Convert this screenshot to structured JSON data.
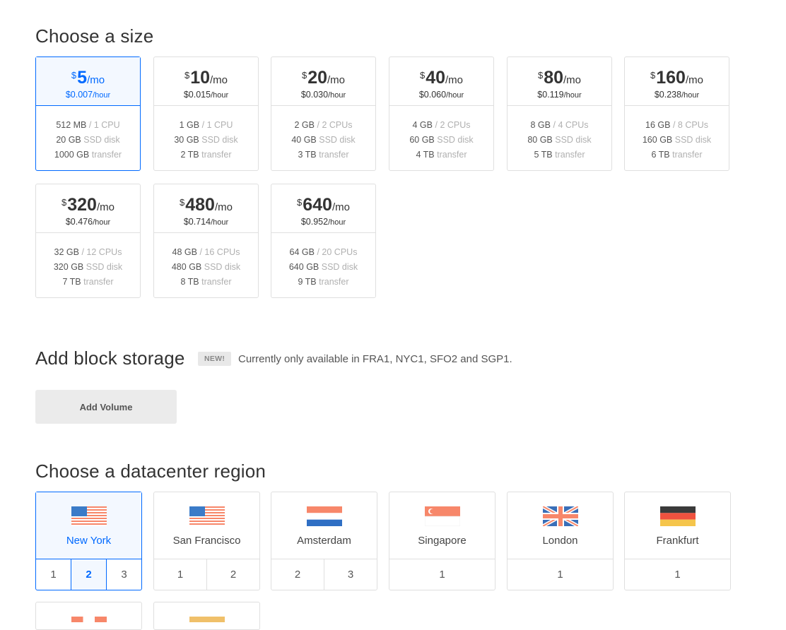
{
  "sizes_section": {
    "title": "Choose a size"
  },
  "sizes": [
    {
      "currency": "$",
      "amount": "5",
      "per": "/mo",
      "hourly": "$0.007",
      "hour_unit": "/hour",
      "ram": "512 MB",
      "cpu": "1 CPU",
      "disk": "20 GB",
      "disk_label": "SSD disk",
      "transfer": "1000 GB",
      "transfer_label": "transfer",
      "selected": true
    },
    {
      "currency": "$",
      "amount": "10",
      "per": "/mo",
      "hourly": "$0.015",
      "hour_unit": "/hour",
      "ram": "1 GB",
      "cpu": "1 CPU",
      "disk": "30 GB",
      "disk_label": "SSD disk",
      "transfer": "2 TB",
      "transfer_label": "transfer",
      "selected": false
    },
    {
      "currency": "$",
      "amount": "20",
      "per": "/mo",
      "hourly": "$0.030",
      "hour_unit": "/hour",
      "ram": "2 GB",
      "cpu": "2 CPUs",
      "disk": "40 GB",
      "disk_label": "SSD disk",
      "transfer": "3 TB",
      "transfer_label": "transfer",
      "selected": false
    },
    {
      "currency": "$",
      "amount": "40",
      "per": "/mo",
      "hourly": "$0.060",
      "hour_unit": "/hour",
      "ram": "4 GB",
      "cpu": "2 CPUs",
      "disk": "60 GB",
      "disk_label": "SSD disk",
      "transfer": "4 TB",
      "transfer_label": "transfer",
      "selected": false
    },
    {
      "currency": "$",
      "amount": "80",
      "per": "/mo",
      "hourly": "$0.119",
      "hour_unit": "/hour",
      "ram": "8 GB",
      "cpu": "4 CPUs",
      "disk": "80 GB",
      "disk_label": "SSD disk",
      "transfer": "5 TB",
      "transfer_label": "transfer",
      "selected": false
    },
    {
      "currency": "$",
      "amount": "160",
      "per": "/mo",
      "hourly": "$0.238",
      "hour_unit": "/hour",
      "ram": "16 GB",
      "cpu": "8 CPUs",
      "disk": "160 GB",
      "disk_label": "SSD disk",
      "transfer": "6 TB",
      "transfer_label": "transfer",
      "selected": false
    },
    {
      "currency": "$",
      "amount": "320",
      "per": "/mo",
      "hourly": "$0.476",
      "hour_unit": "/hour",
      "ram": "32 GB",
      "cpu": "12 CPUs",
      "disk": "320 GB",
      "disk_label": "SSD disk",
      "transfer": "7 TB",
      "transfer_label": "transfer",
      "selected": false
    },
    {
      "currency": "$",
      "amount": "480",
      "per": "/mo",
      "hourly": "$0.714",
      "hour_unit": "/hour",
      "ram": "48 GB",
      "cpu": "16 CPUs",
      "disk": "480 GB",
      "disk_label": "SSD disk",
      "transfer": "8 TB",
      "transfer_label": "transfer",
      "selected": false
    },
    {
      "currency": "$",
      "amount": "640",
      "per": "/mo",
      "hourly": "$0.952",
      "hour_unit": "/hour",
      "ram": "64 GB",
      "cpu": "20 CPUs",
      "disk": "640 GB",
      "disk_label": "SSD disk",
      "transfer": "9 TB",
      "transfer_label": "transfer",
      "selected": false
    }
  ],
  "block_storage": {
    "title": "Add block storage",
    "badge": "NEW!",
    "note": "Currently only available in FRA1, NYC1, SFO2 and SGP1.",
    "button_label": "Add Volume"
  },
  "datacenter_section": {
    "title": "Choose a datacenter region"
  },
  "datacenters": [
    {
      "name": "New York",
      "flag": "us-flag-icon",
      "numbers": [
        "1",
        "2",
        "3"
      ],
      "active": "2",
      "selected": true
    },
    {
      "name": "San Francisco",
      "flag": "us-flag-icon",
      "numbers": [
        "1",
        "2"
      ],
      "active": null,
      "selected": false
    },
    {
      "name": "Amsterdam",
      "flag": "nl-flag-icon",
      "numbers": [
        "2",
        "3"
      ],
      "active": null,
      "selected": false
    },
    {
      "name": "Singapore",
      "flag": "sg-flag-icon",
      "numbers": [
        "1"
      ],
      "active": null,
      "selected": false
    },
    {
      "name": "London",
      "flag": "gb-flag-icon",
      "numbers": [
        "1"
      ],
      "active": null,
      "selected": false
    },
    {
      "name": "Frankfurt",
      "flag": "de-flag-icon",
      "numbers": [
        "1"
      ],
      "active": null,
      "selected": false
    }
  ],
  "colors": {
    "accent": "#0069ff",
    "border": "#dfdfdf",
    "selected_bg": "#f3f8ff"
  }
}
